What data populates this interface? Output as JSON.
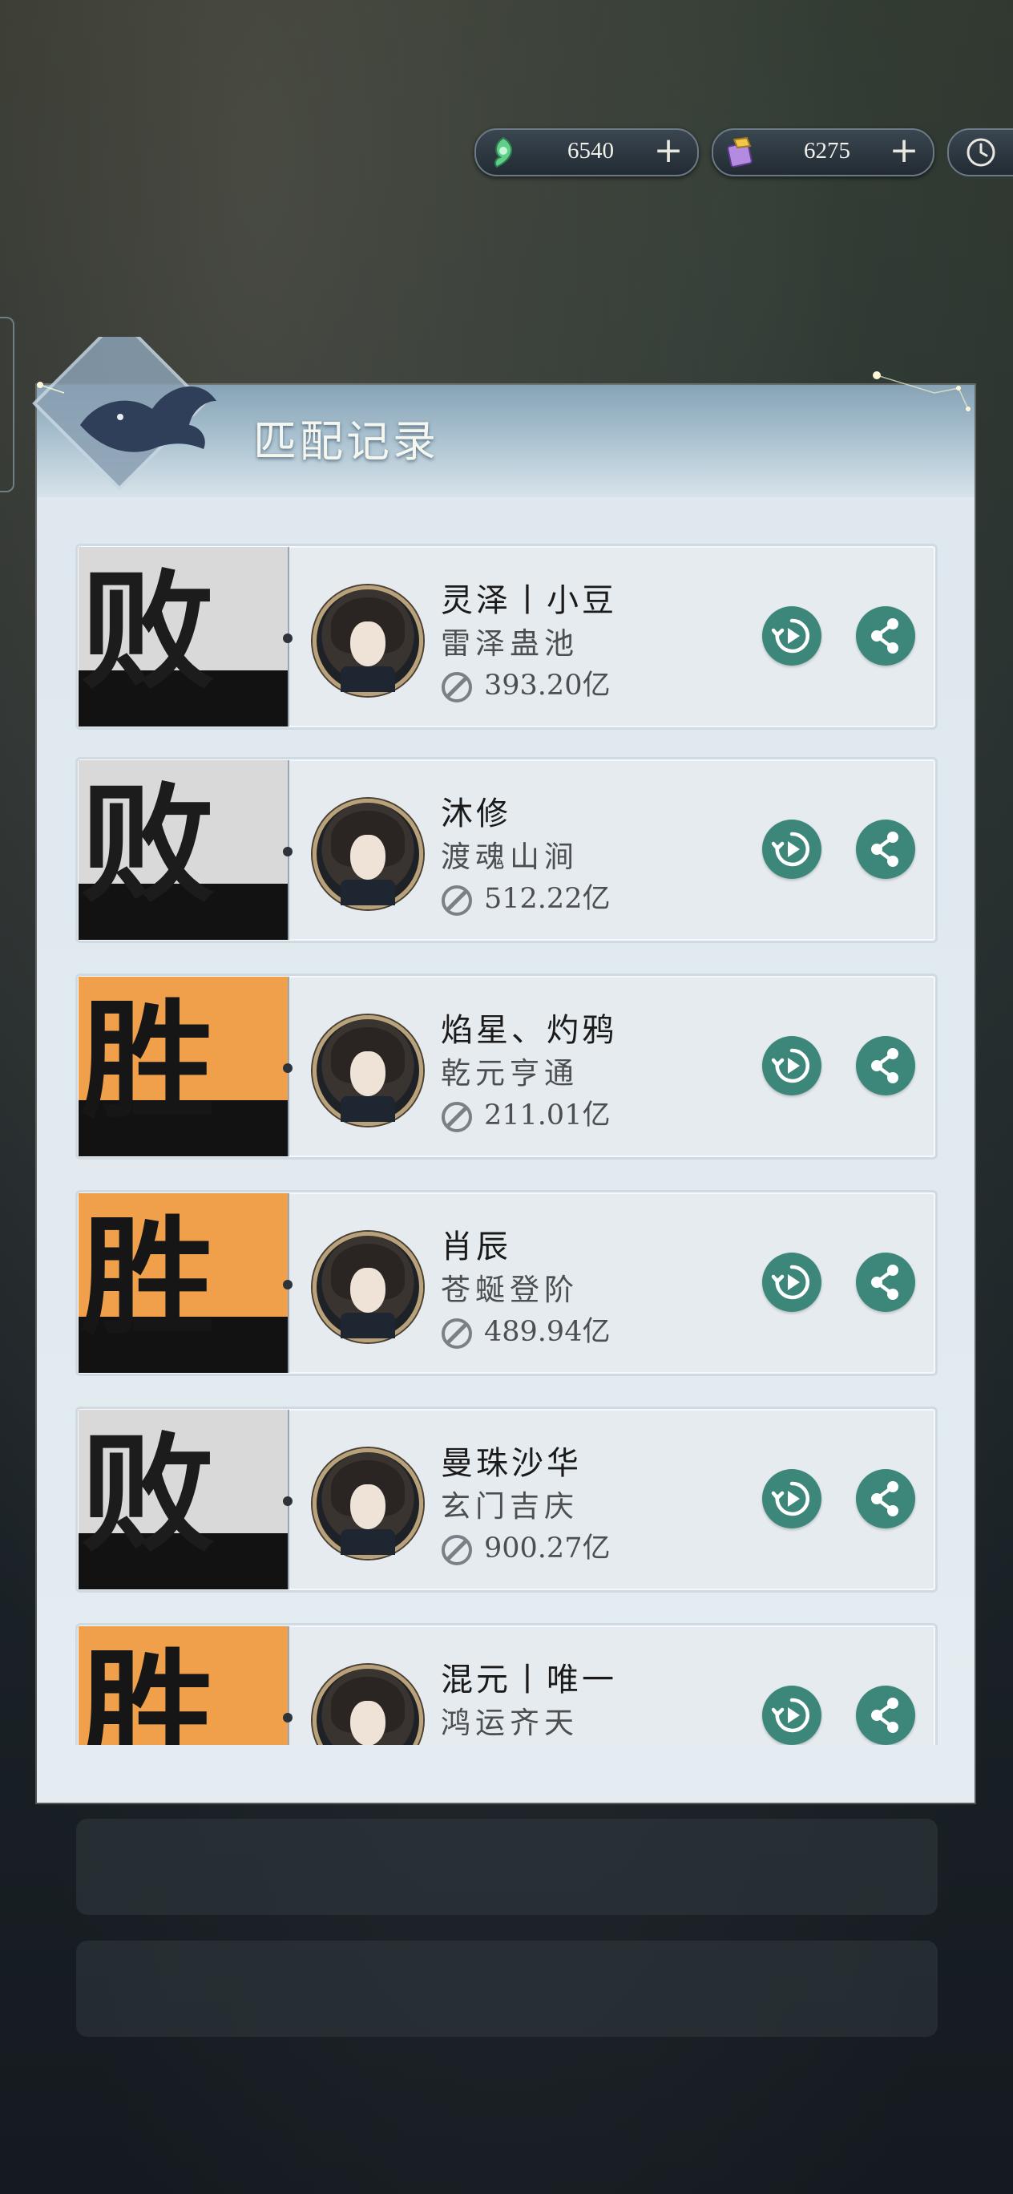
{
  "currency": [
    {
      "name": "jade",
      "icon": "jade-currency-icon",
      "value": "6540"
    },
    {
      "name": "scroll",
      "icon": "scroll-currency-icon",
      "value": "6275"
    }
  ],
  "panel": {
    "title": "匹配记录"
  },
  "colors": {
    "win": "#f0a04a",
    "lose": "#d9d9d9",
    "button": "#3c8779"
  },
  "records": [
    {
      "result": "败",
      "outcome": "lose",
      "name": "灵泽丨小豆",
      "guild": "雷泽蛊池",
      "power": "393.20亿"
    },
    {
      "result": "败",
      "outcome": "lose",
      "name": "沐修",
      "guild": "渡魂山涧",
      "power": "512.22亿"
    },
    {
      "result": "胜",
      "outcome": "win",
      "name": "焰星、灼鸦",
      "guild": "乾元亨通",
      "power": "211.01亿"
    },
    {
      "result": "胜",
      "outcome": "win",
      "name": "肖辰",
      "guild": "苍蜒登阶",
      "power": "489.94亿"
    },
    {
      "result": "败",
      "outcome": "lose",
      "name": "曼珠沙华",
      "guild": "玄门吉庆",
      "power": "900.27亿"
    },
    {
      "result": "胜",
      "outcome": "win",
      "name": "混元丨唯一",
      "guild": "鸿运齐天",
      "power": ""
    }
  ]
}
